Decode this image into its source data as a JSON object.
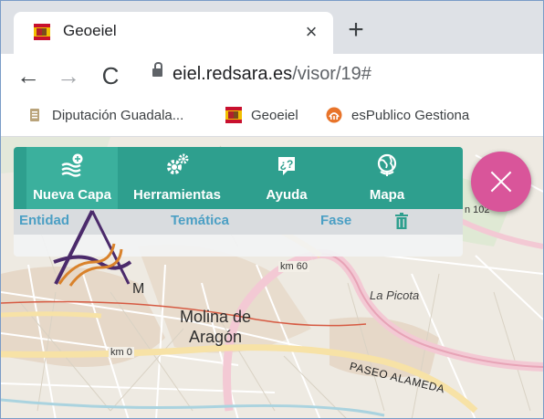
{
  "browser": {
    "tab": {
      "title": "Geoeiel",
      "close_glyph": "×",
      "favicon": "spain-coat-of-arms-icon"
    },
    "new_tab_glyph": "+",
    "nav": {
      "back": "←",
      "forward": "→",
      "reload": "C"
    },
    "url": {
      "host": "eiel.redsara.es",
      "path": "/visor/19#"
    },
    "bookmarks": [
      {
        "label": "Diputación Guadala...",
        "icon": "document-icon"
      },
      {
        "label": "Geoeiel",
        "icon": "spain-coat-of-arms-icon"
      },
      {
        "label": "esPublico Gestiona",
        "icon": "espublico-icon"
      }
    ]
  },
  "app": {
    "menu": [
      {
        "label": "Nueva Capa",
        "icon": "layers-add-icon"
      },
      {
        "label": "Herramientas",
        "icon": "gears-icon"
      },
      {
        "label": "Ayuda",
        "icon": "help-icon"
      },
      {
        "label": "Mapa",
        "icon": "globe-icon"
      }
    ],
    "filters": {
      "entidad": "Entidad",
      "tematica": "Temática",
      "fase": "Fase"
    },
    "colors": {
      "menu_bg": "#2e9f8e",
      "menu_active": "#3bb09d",
      "filter_text": "#4b9fc4",
      "fab": "#d9559a"
    }
  },
  "map": {
    "labels": {
      "molina_line1": "Molina de",
      "molina_line2": "Aragón",
      "picota": "La Picota",
      "paseo": "PASEO ALAMEDA",
      "km60": "km 60",
      "km0": "km 0",
      "km102": "n 102",
      "m": "M"
    }
  }
}
